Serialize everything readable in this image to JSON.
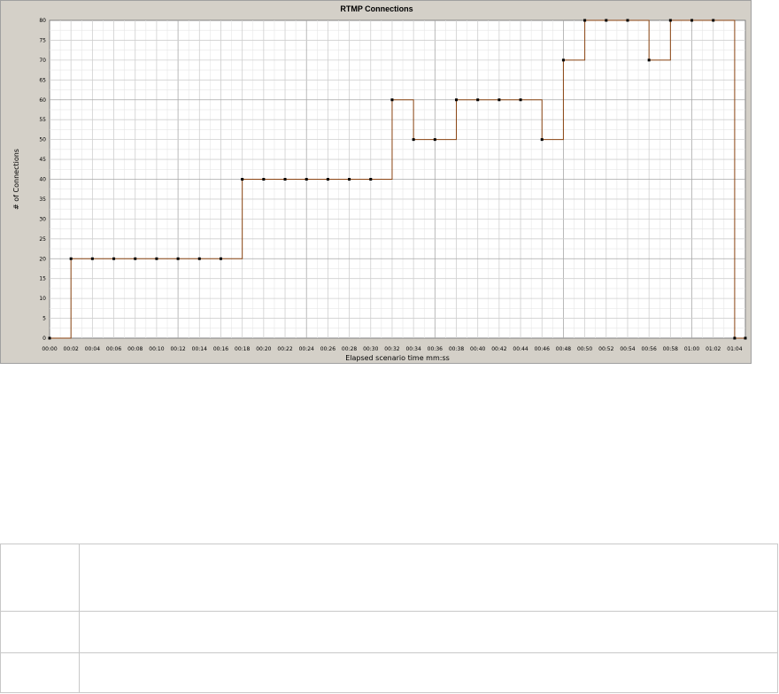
{
  "chart_data": {
    "type": "line",
    "step": true,
    "title": "RTMP Connections",
    "xlabel": "Elapsed scenario time mm:ss",
    "ylabel": "# of Connections",
    "ylim": [
      0,
      80
    ],
    "ytick_step": 5,
    "grid": true,
    "legend": "none",
    "x_tick_labels": [
      "00:00",
      "00:02",
      "00:04",
      "00:06",
      "00:08",
      "00:10",
      "00:12",
      "00:14",
      "00:16",
      "00:18",
      "00:20",
      "00:22",
      "00:24",
      "00:26",
      "00:28",
      "00:30",
      "00:32",
      "00:34",
      "00:36",
      "00:38",
      "00:40",
      "00:42",
      "00:44",
      "00:46",
      "00:48",
      "00:50",
      "00:52",
      "00:54",
      "00:56",
      "00:58",
      "01:00",
      "01:02",
      "01:04"
    ],
    "series": [
      {
        "color": "#8b4513",
        "points": [
          [
            "00:00",
            0
          ],
          [
            "00:02",
            20
          ],
          [
            "00:04",
            20
          ],
          [
            "00:06",
            20
          ],
          [
            "00:08",
            20
          ],
          [
            "00:10",
            20
          ],
          [
            "00:12",
            20
          ],
          [
            "00:14",
            20
          ],
          [
            "00:16",
            20
          ],
          [
            "00:18",
            40
          ],
          [
            "00:20",
            40
          ],
          [
            "00:22",
            40
          ],
          [
            "00:24",
            40
          ],
          [
            "00:26",
            40
          ],
          [
            "00:28",
            40
          ],
          [
            "00:30",
            40
          ],
          [
            "00:32",
            60
          ],
          [
            "00:34",
            50
          ],
          [
            "00:36",
            50
          ],
          [
            "00:38",
            60
          ],
          [
            "00:40",
            60
          ],
          [
            "00:42",
            60
          ],
          [
            "00:44",
            60
          ],
          [
            "00:46",
            50
          ],
          [
            "00:48",
            70
          ],
          [
            "00:50",
            80
          ],
          [
            "00:52",
            80
          ],
          [
            "00:54",
            80
          ],
          [
            "00:56",
            70
          ],
          [
            "00:58",
            80
          ],
          [
            "01:00",
            80
          ],
          [
            "01:02",
            80
          ],
          [
            "01:04",
            0
          ],
          [
            "01:05",
            0
          ]
        ]
      }
    ]
  }
}
